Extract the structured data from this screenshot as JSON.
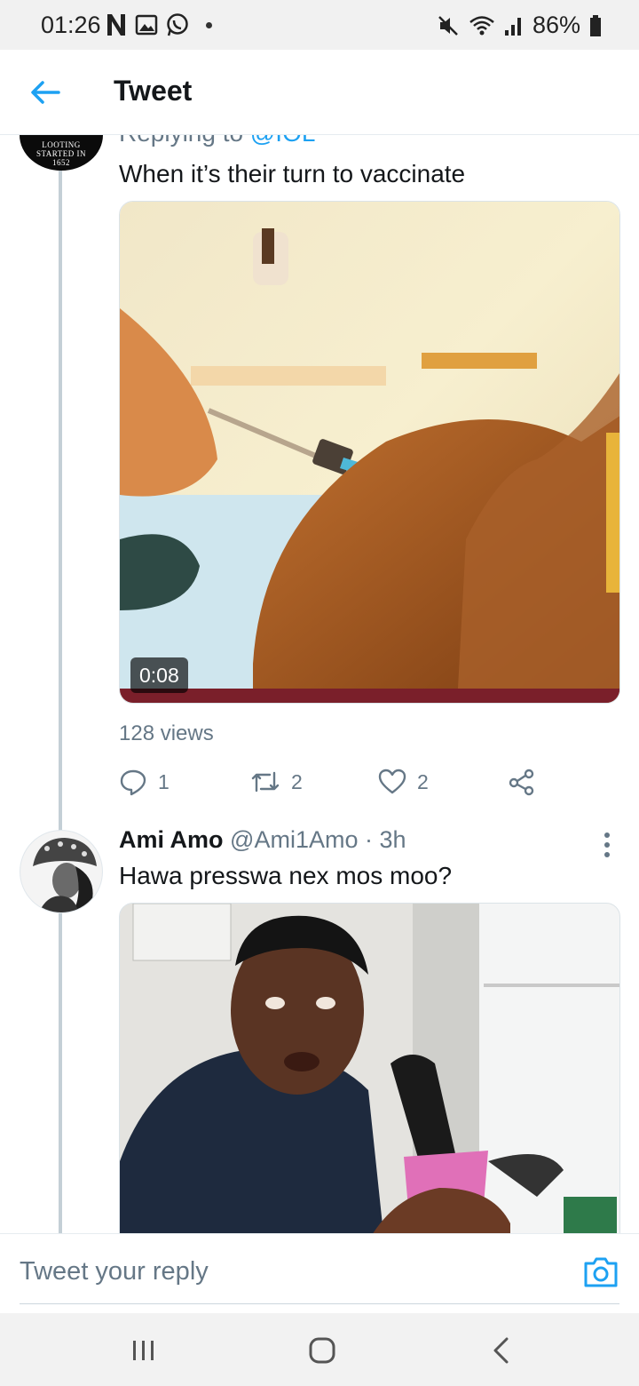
{
  "status_bar": {
    "time": "01:26",
    "battery": "86%",
    "left_icons": [
      "netflix-n-icon",
      "gallery-icon",
      "whatsapp-icon"
    ],
    "right_icons": [
      "mute-icon",
      "wifi-icon",
      "signal-icon",
      "battery-icon"
    ]
  },
  "header": {
    "title": "Tweet"
  },
  "tweets": [
    {
      "avatar_text": "LOOTING STARTED IN 1652",
      "replying_label": "Replying to",
      "replying_handle": "@IOL",
      "text": "When it’s their turn to vaccinate",
      "video_duration": "0:08",
      "views": "128 views",
      "replies": "1",
      "retweets": "2",
      "likes": "2"
    },
    {
      "name": "Ami Amo",
      "handle": "@Ami1Amo",
      "time": "· 3h",
      "text": "Hawa presswa nex mos moo?"
    }
  ],
  "reply_bar": {
    "placeholder": "Tweet your reply"
  },
  "colors": {
    "accent": "#1da1f2",
    "muted": "#657786",
    "thread_line": "#c4cfd6"
  }
}
